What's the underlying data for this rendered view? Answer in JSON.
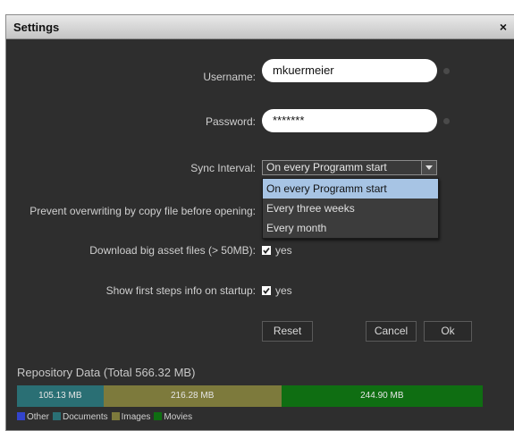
{
  "dialog": {
    "title": "Settings",
    "close": "×"
  },
  "form": {
    "username_label": "Username:",
    "username_value": "mkuermeier",
    "password_label": "Password:",
    "password_value": "*******",
    "sync_label": "Sync Interval:",
    "sync_selected": "On every Programm start",
    "sync_options": [
      "On every Programm start",
      "Every three weeks",
      "Every month"
    ],
    "prevent_label": "Prevent overwriting by copy file before opening:",
    "download_label": "Download big asset files (> 50MB):",
    "download_value": "yes",
    "firststeps_label": "Show first steps info on startup:",
    "firststeps_value": "yes"
  },
  "buttons": {
    "reset": "Reset",
    "cancel": "Cancel",
    "ok": "Ok"
  },
  "repository": {
    "title": "Repository Data (Total 566.32 MB)",
    "segments": [
      {
        "label": "105.13 MB",
        "name": "Documents",
        "mb": 105.13,
        "color": "#2a6f74"
      },
      {
        "label": "216.28 MB",
        "name": "Images",
        "mb": 216.28,
        "color": "#7d7a3c"
      },
      {
        "label": "244.90 MB",
        "name": "Movies",
        "mb": 244.9,
        "color": "#0f6e12"
      }
    ],
    "legend": [
      {
        "label": "Other",
        "color": "#3344cc"
      },
      {
        "label": "Documents",
        "color": "#2a6f74"
      },
      {
        "label": "Images",
        "color": "#7d7a3c"
      },
      {
        "label": "Movies",
        "color": "#0f6e12"
      }
    ]
  }
}
